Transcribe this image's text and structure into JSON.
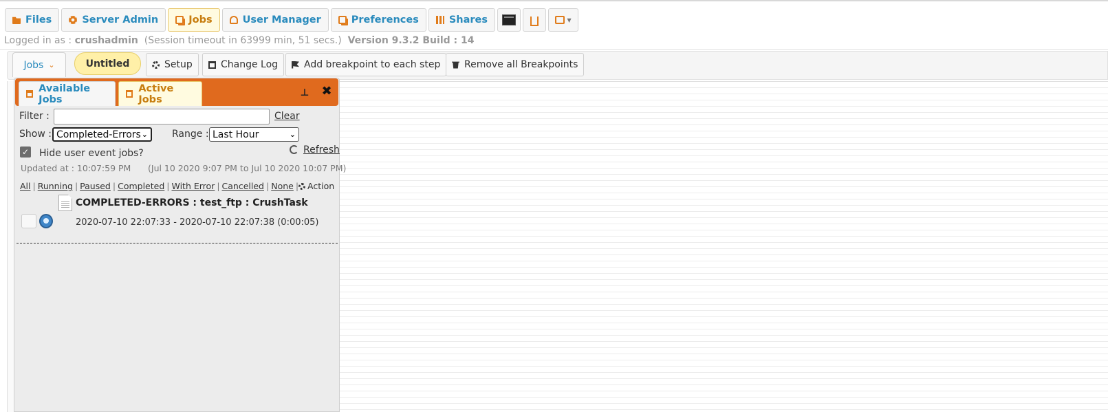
{
  "nav": {
    "files": "Files",
    "server_admin": "Server Admin",
    "jobs": "Jobs",
    "user_manager": "User Manager",
    "preferences": "Preferences",
    "shares": "Shares"
  },
  "session": {
    "logged_in_prefix": "Logged in as :",
    "username": "crushadmin",
    "timeout": "(Session timeout in 63999 min, 51 secs.)",
    "version": "Version 9.3.2 Build : 14"
  },
  "toolbar": {
    "jobs_dropdown": "Jobs",
    "job_name": "Untitled",
    "setup": "Setup",
    "change_log": "Change Log",
    "add_breakpoint": "Add breakpoint to each step",
    "remove_breakpoints": "Remove all Breakpoints"
  },
  "panel": {
    "tabs": {
      "available": "Available Jobs",
      "active": "Active Jobs"
    },
    "filter_label": "Filter :",
    "filter_value": "",
    "clear": "Clear",
    "show_label": "Show :",
    "show_value": "Completed-Errors",
    "range_label": "Range :",
    "range_value": "Last Hour",
    "hide_user_events": "Hide user event jobs?",
    "hide_user_events_checked": true,
    "refresh": "Refresh",
    "updated_at": "Updated at : 10:07:59 PM",
    "time_window": "(Jul 10 2020 9:07 PM to Jul 10 2020 10:07 PM)",
    "filters": [
      "All",
      "Running",
      "Paused",
      "Completed",
      "With Error",
      "Cancelled",
      "None"
    ],
    "action": "Action",
    "job": {
      "title": "COMPLETED-ERRORS : test_ftp : CrushTask",
      "times": "2020-07-10 22:07:33 - 2020-07-10 22:07:38 (0:00:05)"
    }
  },
  "colors": {
    "accent_orange": "#e06a1e",
    "link_blue": "#2a8bbd",
    "active_tab_bg": "#fffbe0",
    "untitled_pill": "#fff0a8"
  }
}
